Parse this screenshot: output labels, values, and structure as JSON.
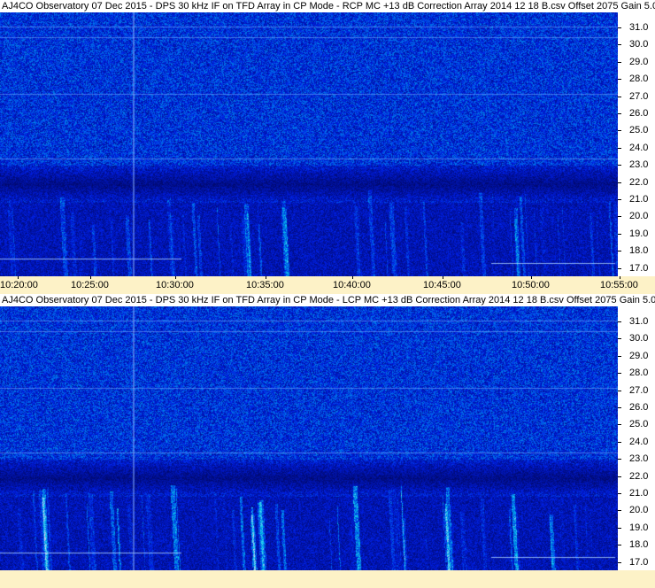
{
  "panels": [
    {
      "id": "rcp",
      "title": "AJ4CO Observatory 07 Dec 2015 - DPS 30 kHz IF on TFD Array in CP Mode - RCP  MC +13 dB  Correction Array 2014 12 18 B.csv  Offset 2075  Gain 5.0",
      "freq_ticks": [
        "31.0",
        "30.0",
        "29.0",
        "28.0",
        "27.0",
        "26.0",
        "25.0",
        "24.0",
        "23.0",
        "22.0",
        "21.0",
        "20.0",
        "19.0",
        "18.0",
        "17.0"
      ],
      "time_ticks": [
        "10:20:00",
        "10:25:00",
        "10:30:00",
        "10:35:00",
        "10:40:00",
        "10:45:00",
        "10:50:00",
        "10:55:00"
      ]
    },
    {
      "id": "lcp",
      "title": "AJ4CO Observatory 07 Dec 2015 - DPS 30 kHz IF on TFD Array in CP Mode - LCP  MC +13 dB  Correction Array 2014 12 18 B.csv  Offset 2075  Gain 5.0",
      "freq_ticks": [
        "31.0",
        "30.0",
        "29.0",
        "28.0",
        "27.0",
        "26.0",
        "25.0",
        "24.0",
        "23.0",
        "22.0",
        "21.0",
        "20.0",
        "19.0",
        "18.0",
        "17.0"
      ],
      "time_ticks": []
    }
  ],
  "colors": {
    "time_axis_bg": "#fdf2c7",
    "axis_bg": "#ffffff"
  }
}
